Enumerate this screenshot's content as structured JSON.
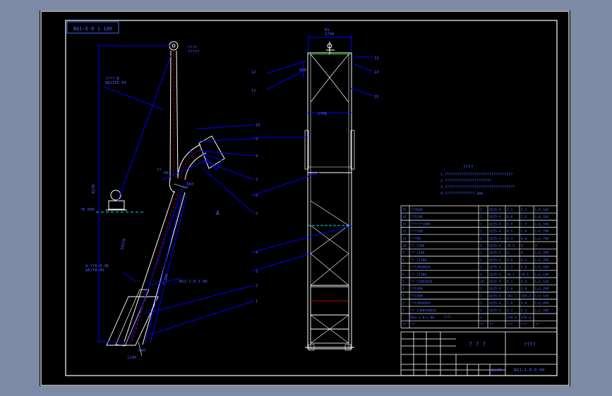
{
  "drawing": {
    "code_box": "BG1-E-D-1-100",
    "title_block": {
      "title_left": "? ? ?",
      "title_right": "????",
      "drawing_no": "BG1-1.0.0-00",
      "scale": "1:10"
    },
    "notes_heading": "????",
    "notes": [
      "1.????????????????????????????????",
      "2.??????????????????????",
      "3.?????????????????????????????????",
      "4.??????????????-2mm"
    ],
    "left_view": {
      "top_label": "????",
      "top_label2": "?????",
      "pulley_label": "????-B",
      "pulley_label2": "GB1165-94",
      "ground_label": "?0.000",
      "section_label": "A",
      "bottom_label": "1190",
      "bottom_label2": "840",
      "motor_label": "A-??0-0.36",
      "motor_label2": "GB/T8-89",
      "casing_label": "BG1-1.0.1-00",
      "height_dim": "8270",
      "shaft_dim": "16270",
      "angle_label": "60°",
      "slot_label": "350",
      "tilt_label": "??"
    },
    "right_view": {
      "top_width": "1700",
      "top_height": "H1",
      "mid_width": "1700",
      "small_dim": "600",
      "callouts": [
        "12",
        "11",
        "13",
        "14",
        "15"
      ]
    },
    "left_callouts": [
      "10",
      "9",
      "8",
      "7",
      "6",
      "5",
      "4",
      "3",
      "2",
      "1"
    ],
    "parts_table": {
      "rows": [
        {
          "no": "15",
          "name": "??1000",
          "qty": "2",
          "mat": "Q235-A",
          "w1": "2.1",
          "w2": "4.2",
          "note": "L=5,104"
        },
        {
          "no": "14",
          "name": "??1100",
          "qty": "2",
          "mat": "Q235-A",
          "w1": "0.8",
          "w2": "1.6",
          "note": "L=6,104"
        },
        {
          "no": "13",
          "name": "??????1000",
          "qty": "1",
          "mat": "Q235-A",
          "w1": "0.9",
          "w2": "1.5",
          "note": "L=1,504"
        },
        {
          "no": "12",
          "name": "???100",
          "qty": "2",
          "mat": "Q235-A",
          "w1": "0.5",
          "w2": "1.0",
          "note": "L=1,70#"
        },
        {
          "no": "11",
          "name": "???80",
          "qty": "2",
          "mat": "Q235-A",
          "w1": "0.4",
          "w2": "0.8",
          "note": "L=1,70#"
        },
        {
          "no": "10",
          "name": "?? 1300",
          "qty": "4",
          "mat": "Q235-A",
          "w1": "18.8",
          "w2": "8",
          "note": "8"
        },
        {
          "no": "9",
          "name": "?? 1100",
          "qty": "1",
          "mat": "Q235-A",
          "w1": "8",
          "w2": "8",
          "note": "L=1,39#"
        },
        {
          "no": "8",
          "name": "?? 11300",
          "qty": "1",
          "mat": "Q235-A",
          "w1": "8.0",
          "w2": "8.4",
          "note": "L=1,39#"
        },
        {
          "no": "7",
          "name": "??L40X40X4",
          "qty": "1",
          "mat": "Q235-A",
          "w1": "1.2",
          "w2": "1.6",
          "note": "L=1,58#"
        },
        {
          "no": "6",
          "name": "?? 11300",
          "qty": "1",
          "mat": "Q235-A",
          "w1": "18.1",
          "w2": "20.6",
          "note": "L=1,19#"
        },
        {
          "no": "5",
          "name": "?? L50X50X4",
          "qty": "16",
          "mat": "Q235-A",
          "w1": "0.3",
          "w2": "4.8",
          "note": "L=1,52#"
        },
        {
          "no": "4",
          "name": "??1300",
          "qty": "1",
          "mat": "Q235-A",
          "w1": "2.0",
          "w2": "2.0",
          "note": "L=1,28#"
        },
        {
          "no": "3",
          "name": "??1300",
          "qty": "1",
          "mat": "Q235-A",
          "w1": "181.1",
          "w2": "104.4",
          "note": "L=1,52#"
        },
        {
          "no": "2",
          "name": "??L40X40X4",
          "qty": "2",
          "mat": "Q235-A",
          "w1": "2.8",
          "w2": "5.6",
          "note": "L=1,84#"
        },
        {
          "no": "1",
          "name": "?? 1300X900X8",
          "qty": "1",
          "mat": "Q235-A",
          "w1": "0.3",
          "w2": "6.4",
          "note": "L=1,58#"
        }
      ],
      "subtotal_code": "BG1-1.0.1-00",
      "subtotal_name": "????",
      "subtotal_qty": "1",
      "subtotal_w1": "178.4",
      "subtotal_w2": "178.4",
      "header": {
        "no": "??",
        "name": "??",
        "qty": "??",
        "mat": "??",
        "w1": "???",
        "w2": "???",
        "note": "??"
      }
    }
  },
  "colors": {
    "background": "#000000",
    "frame": "#ffffff",
    "outline": "#0000ff",
    "blue_text": "#4a63ff",
    "red_axis": "#ff0000",
    "cyan": "#00d8d8",
    "page": "#7d8aa6"
  }
}
